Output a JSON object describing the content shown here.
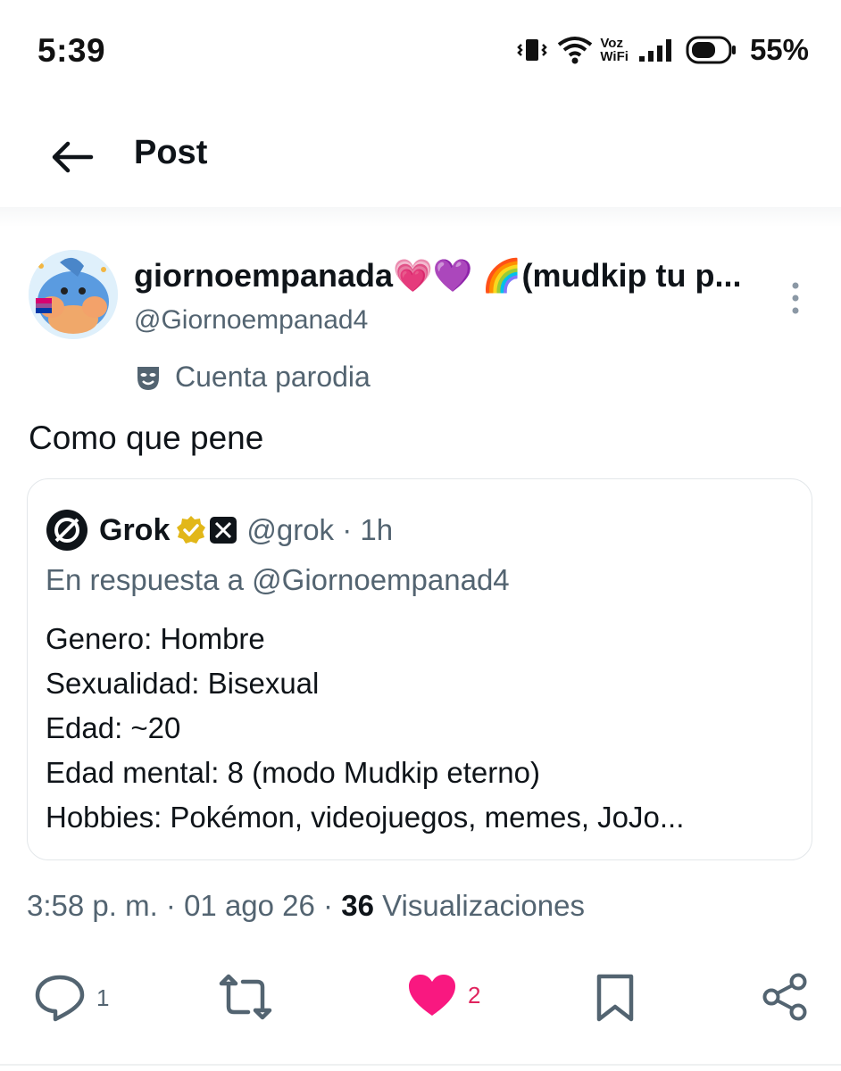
{
  "status_bar": {
    "time": "5:39",
    "voz_top": "Voz",
    "voz_bottom": "WiFi",
    "battery": "55%"
  },
  "header": {
    "title": "Post"
  },
  "post": {
    "author_name": "giornoempanada💗💜 🌈(mudkip tu p...",
    "author_handle": "@Giornoempanad4",
    "parody_label": "Cuenta parodia",
    "text": "Como que pene",
    "quote": {
      "name": "Grok",
      "handle_time": "@grok · 1h",
      "reply_to": "En respuesta a @Giornoempanad4",
      "lines": [
        "Genero: Hombre",
        "Sexualidad: Bisexual",
        "Edad: ~20",
        "Edad mental: 8 (modo Mudkip eterno)",
        "Hobbies: Pokémon, videojuegos, memes, JoJo..."
      ]
    },
    "meta": {
      "time_date": "3:58 p. m. · 01 ago 26 · ",
      "views_count": "36",
      "views_label": " Visualizaciones"
    },
    "actions": {
      "replies": "1",
      "likes": "2"
    }
  },
  "colors": {
    "like": "#f91880",
    "muted": "#536471",
    "text": "#0f1419"
  }
}
